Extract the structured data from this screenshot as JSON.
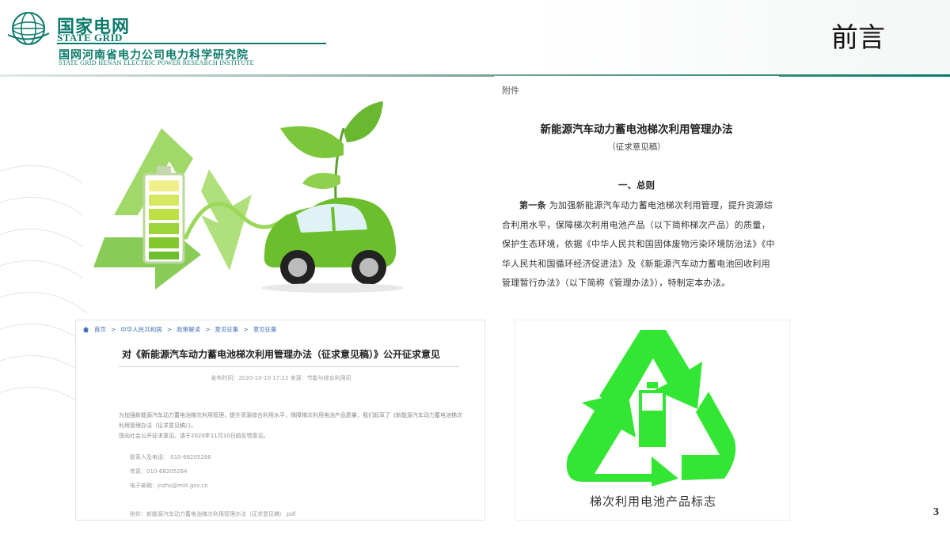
{
  "header": {
    "brand_cn": "国家电网",
    "brand_en": "STATE GRID",
    "institute_cn": "国网河南省电力公司电力科学研究院",
    "institute_en": "STATE GRID HENAN ELECTRIC POWER RESEARCH INSTITUTE",
    "page_title": "前言"
  },
  "document": {
    "attachment_label": "附件",
    "title": "新能源汽车动力蓄电池梯次利用管理办法",
    "subtitle": "（征求意见稿）",
    "section": "一、总则",
    "article_label": "第一条",
    "article_text": "为加强新能源汽车动力蓄电池梯次利用管理，提升资源综合利用水平，保障梯次利用电池产品（以下简称梯次产品）的质量，保护生态环境，依据《中华人民共和国固体废物污染环境防治法》《中华人民共和国循环经济促进法》及《新能源汽车动力蓄电池回收利用管理暂行办法》（以下简称《管理办法》），特制定本办法。"
  },
  "webpage": {
    "breadcrumb": [
      "首页",
      "中华人民共和国",
      "政策解读",
      "意见征集",
      "意见征集"
    ],
    "title": "对《新能源汽车动力蓄电池梯次利用管理办法（征求意见稿）》公开征求意见",
    "meta": "发布时间：2020-10-10 17:22   来源：节能与综合利用司",
    "body_line1": "为加强新能源汽车动力蓄电池梯次利用管理，提升资源综合利用水平，保障梯次利用电池产品质量，我们起草了《新能源汽车动力蓄电池梯次利用管理办法（征求意见稿）》，",
    "body_line2": "现向社会公开征求意见。请于2020年11月10日前反馈意见。",
    "contact_person": "联系人及电话：",
    "contact_phone": "010-68205266",
    "contact_fax": "传真：010-68205264",
    "contact_email": "电子邮箱：jnzhs@miit.gov.cn",
    "attachment": "附件：新能源汽车动力蓄电池梯次利用管理办法（征求意见稿）.pdf"
  },
  "recycle": {
    "caption": "梯次利用电池产品标志"
  },
  "page_number": "3",
  "colors": {
    "brand_green": "#0a7a6a",
    "recycle_green": "#33e633",
    "leaf_green": "#6cbf2c"
  }
}
